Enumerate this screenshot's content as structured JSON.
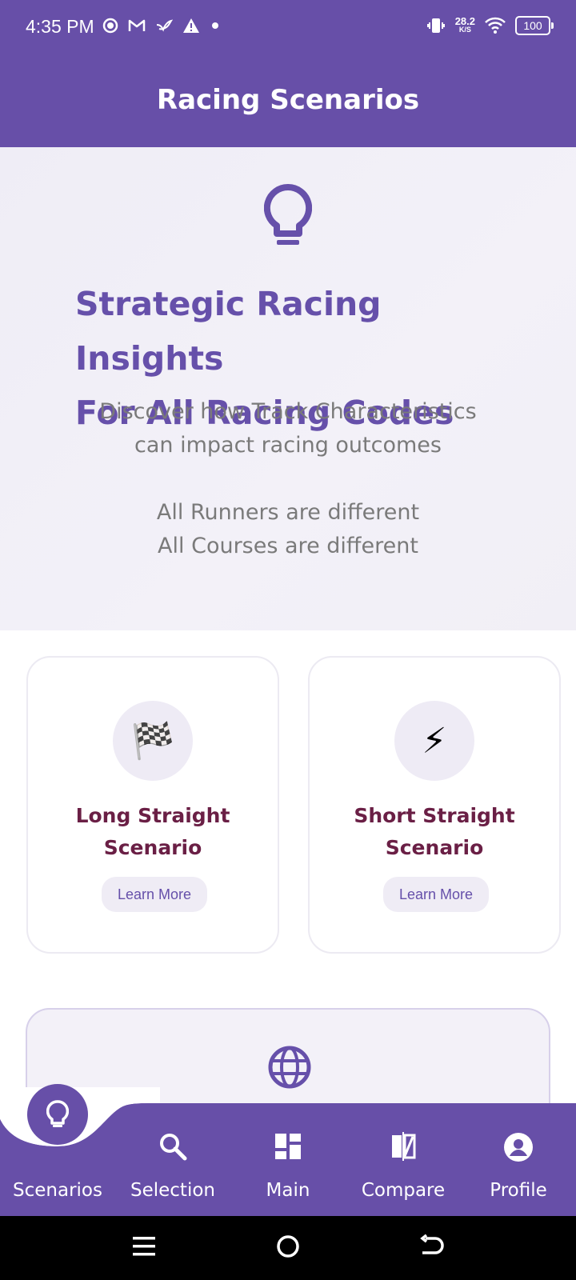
{
  "status_bar": {
    "time": "4:35 PM",
    "net_speed_value": "28.2",
    "net_speed_unit": "K/S",
    "battery": "100",
    "icons_left": [
      "sync-icon",
      "gmail-icon",
      "bird-icon",
      "warning-icon",
      "dot-icon"
    ],
    "icons_right": [
      "vibrate-icon",
      "wifi-icon",
      "battery-icon"
    ]
  },
  "app_bar": {
    "title": "Racing Scenarios"
  },
  "hero": {
    "icon": "lightbulb-icon",
    "title_line1": "Strategic Racing Insights",
    "title_line2": "For All Racing Codes",
    "subtitle_line1": "Discover how Track Characteristics",
    "subtitle_line2": "can impact racing outcomes",
    "note_line1": "All Runners are different",
    "note_line2": "All Courses are different"
  },
  "cards": [
    {
      "icon": "🏁",
      "title_line1": "Long Straight",
      "title_line2": "Scenario",
      "button": "Learn More"
    },
    {
      "icon": "⚡",
      "title_line1": "Short Straight",
      "title_line2": "Scenario",
      "button": "Learn More"
    }
  ],
  "globe_card": {
    "icon": "globe-icon"
  },
  "bottom_nav": {
    "active": "Scenarios",
    "items": [
      {
        "label": "Scenarios",
        "icon": "lightbulb-icon"
      },
      {
        "label": "Selection",
        "icon": "search-icon"
      },
      {
        "label": "Main",
        "icon": "dashboard-icon"
      },
      {
        "label": "Compare",
        "icon": "compare-icon"
      },
      {
        "label": "Profile",
        "icon": "account-circle-icon"
      }
    ]
  },
  "system_nav": {
    "icons": [
      "menu-icon",
      "home-icon",
      "back-icon"
    ]
  },
  "colors": {
    "primary": "#674FA8",
    "hero_title": "#6650AA",
    "card_title": "#6A1F45",
    "subtitle": "#7A7A7A"
  }
}
